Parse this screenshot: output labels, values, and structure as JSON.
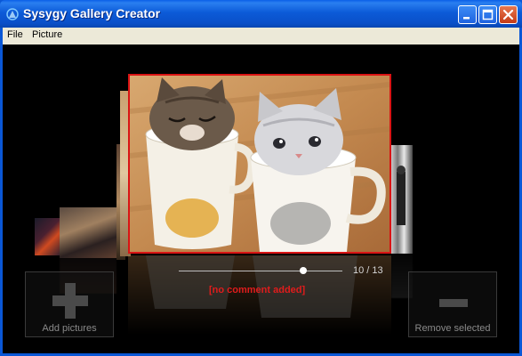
{
  "window": {
    "title": "Sysygy Gallery Creator",
    "accent_color": "#0a57d6",
    "close_color": "#c43b16"
  },
  "menu": {
    "items": [
      {
        "label": "File"
      },
      {
        "label": "Picture"
      }
    ]
  },
  "gallery": {
    "current_index": 10,
    "total": 13,
    "counter_text": "10 / 13",
    "comment": "[no comment added]",
    "selection_border_color": "#d91414",
    "main_photo_subject": "two-kittens-in-mugs"
  },
  "actions": {
    "add_label": "Add pictures",
    "remove_label": "Remove selected"
  },
  "icons": {
    "app": "gallery-app-icon",
    "add": "plus-icon",
    "remove": "minus-icon"
  }
}
